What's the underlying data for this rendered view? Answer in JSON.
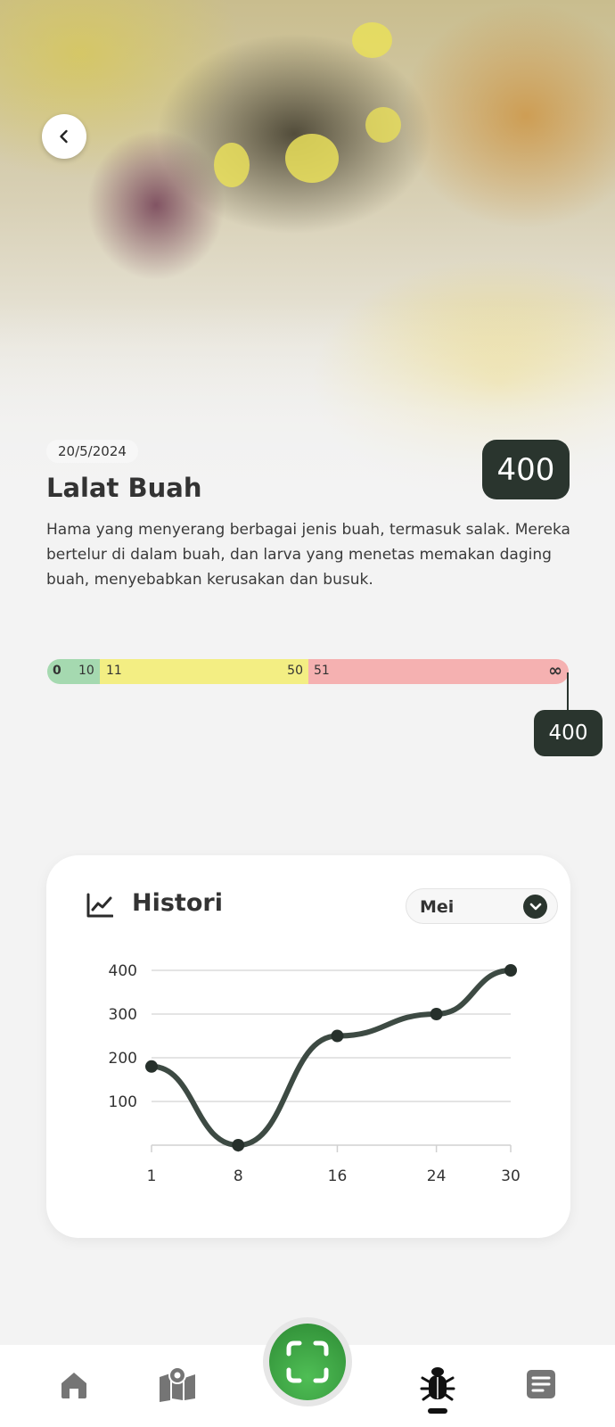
{
  "header": {
    "back_icon": "chevron-left-icon",
    "date": "20/5/2024",
    "title": "Lalat Buah",
    "count": "400",
    "description": "Hama yang menyerang berbagai jenis buah, termasuk salak. Mereka bertelur di dalam buah, dan larva yang menetas memakan daging buah, menyebabkan kerusakan dan busuk."
  },
  "scale": {
    "green": {
      "min": "0",
      "max": "10",
      "color": "#a5d9b0"
    },
    "yellow": {
      "min": "11",
      "max": "50",
      "color": "#f3ee83"
    },
    "red": {
      "min": "51",
      "max": "∞",
      "color": "#f5b1b1"
    },
    "current_value": "400"
  },
  "history": {
    "title": "Histori",
    "icon": "line-chart-icon",
    "month": "Mei"
  },
  "chart_data": {
    "type": "line",
    "x": [
      1,
      8,
      16,
      24,
      30
    ],
    "y": [
      180,
      0,
      250,
      300,
      400
    ],
    "xticks": [
      "1",
      "8",
      "16",
      "24",
      "30"
    ],
    "yticks": [
      "100",
      "200",
      "300",
      "400"
    ],
    "ylim": [
      0,
      400
    ],
    "grid": true,
    "line_color": "#3d4a43"
  },
  "nav": {
    "items": [
      {
        "icon": "home-icon",
        "active": false
      },
      {
        "icon": "map-icon",
        "active": false
      },
      {
        "icon": "scan-icon",
        "active": false
      },
      {
        "icon": "bug-icon",
        "active": true
      },
      {
        "icon": "document-icon",
        "active": false
      }
    ],
    "accent": "#3aa541"
  }
}
